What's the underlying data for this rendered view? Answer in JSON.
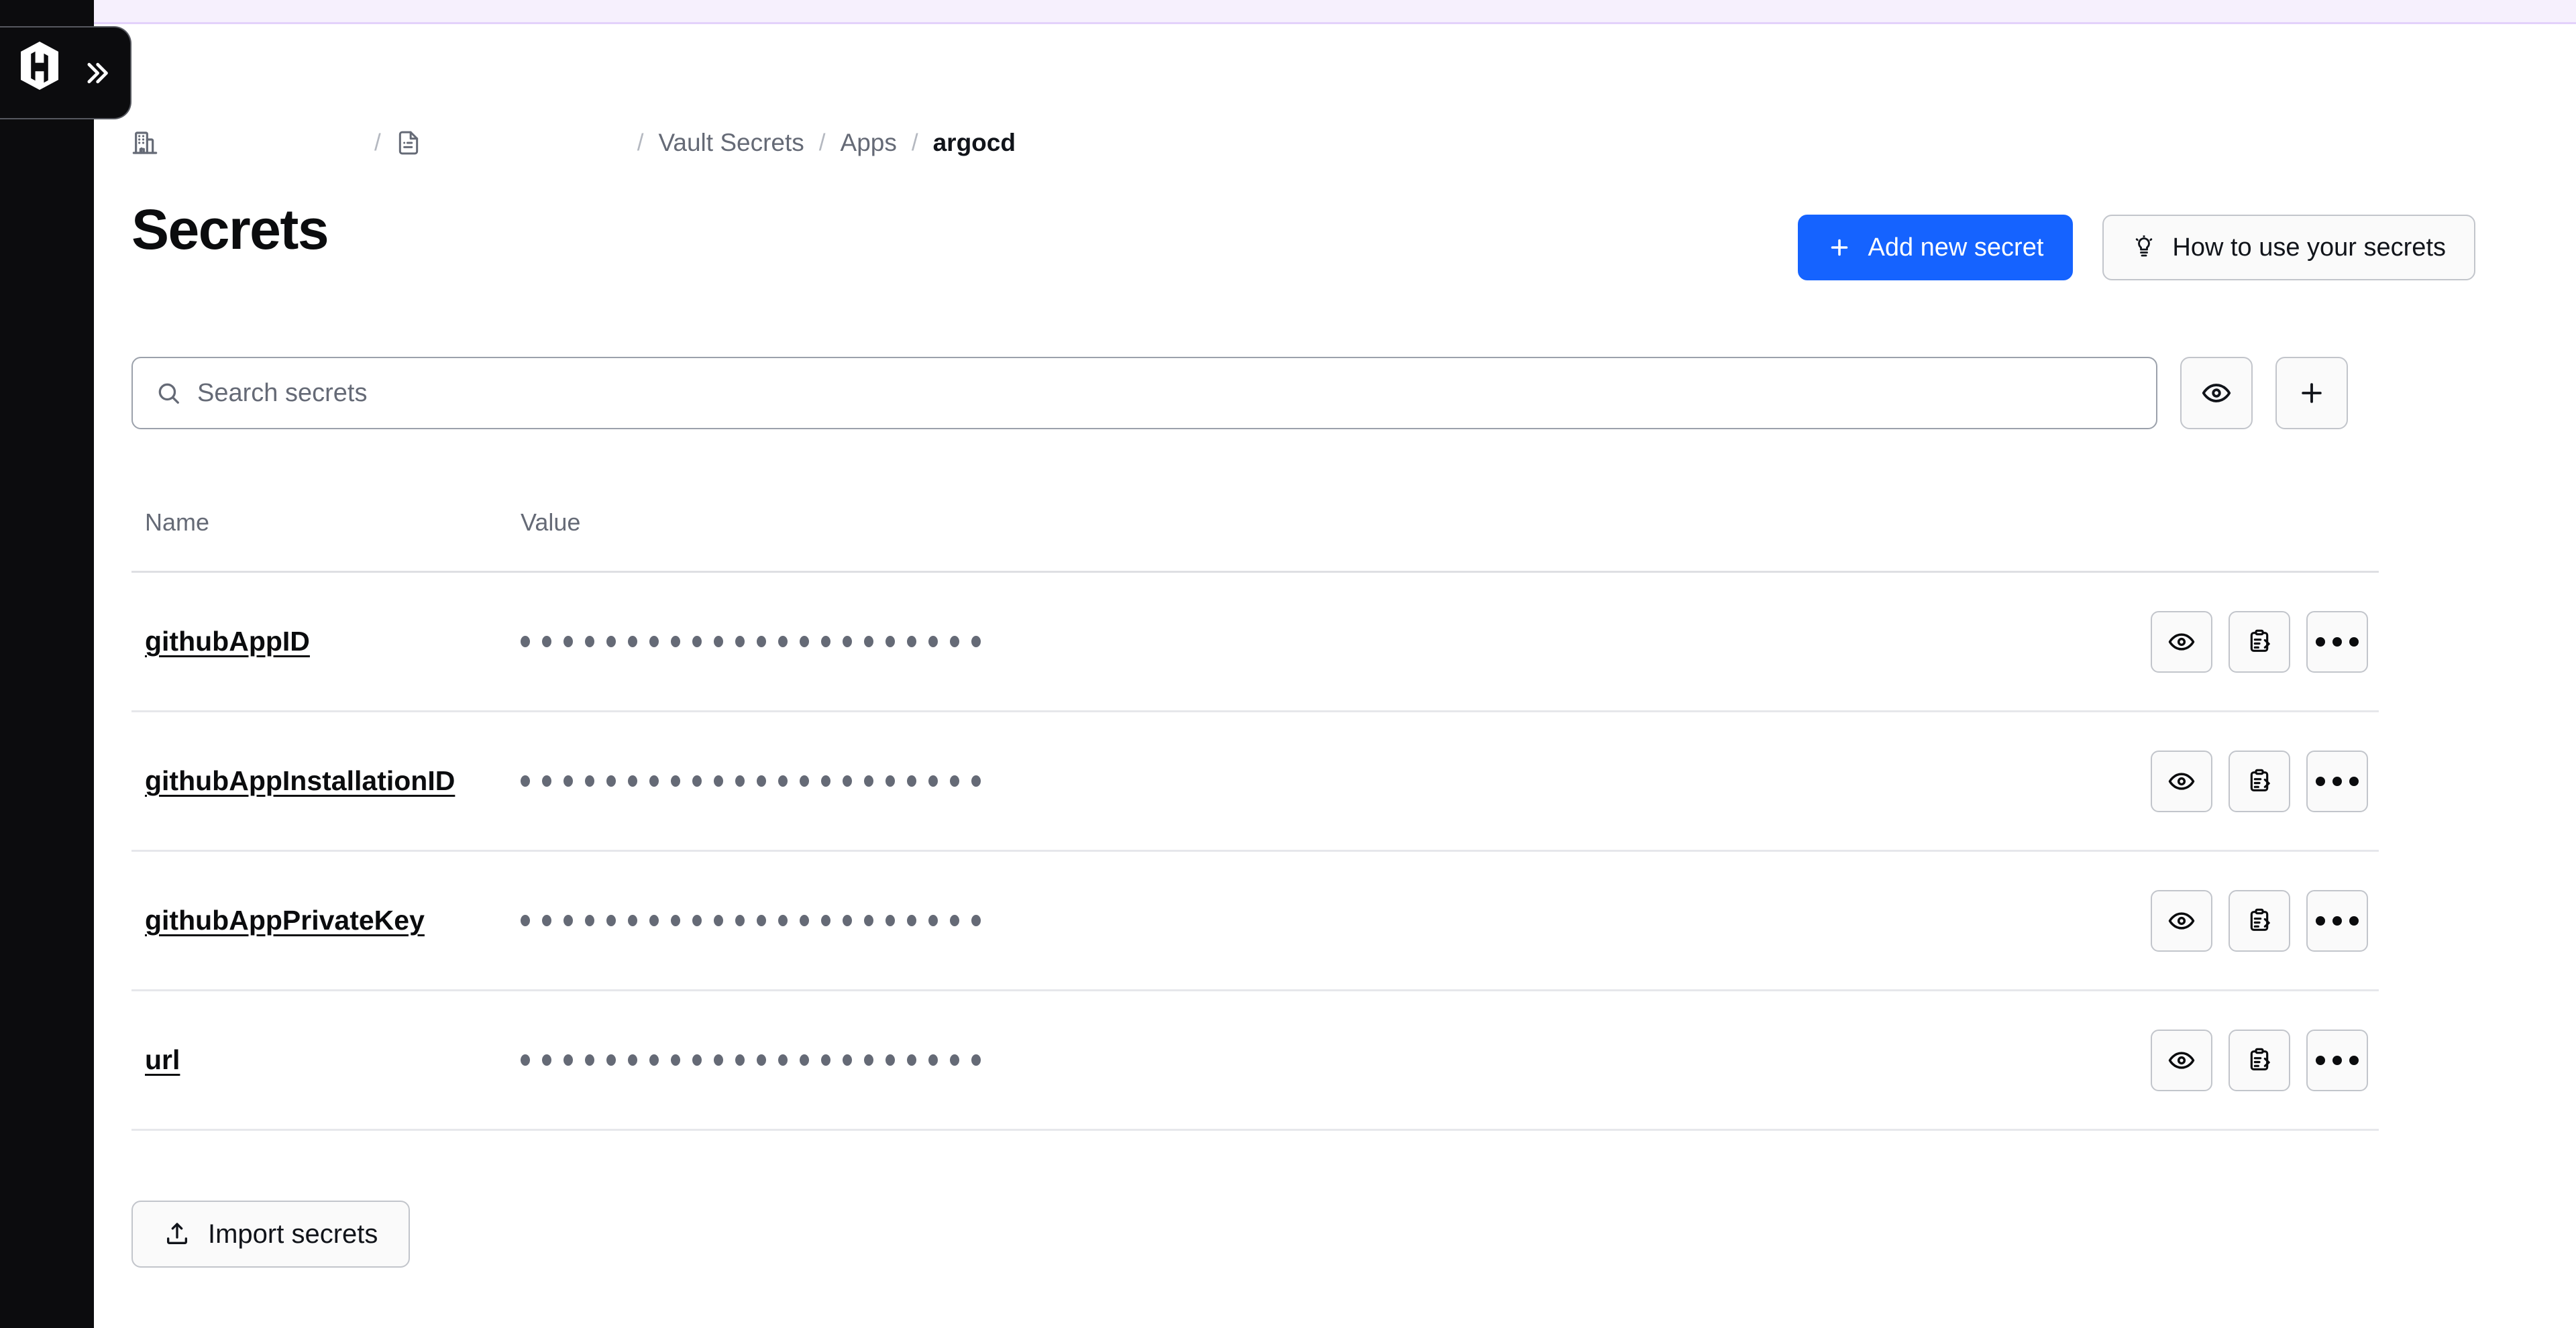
{
  "app": {
    "logo": "hashicorp-logo",
    "sidebar_expand_label": "»"
  },
  "breadcrumb": {
    "org_icon": "org-building-icon",
    "project_icon": "project-document-icon",
    "separator": "/",
    "items": [
      {
        "label": "Vault Secrets",
        "current": false
      },
      {
        "label": "Apps",
        "current": false
      },
      {
        "label": "argocd",
        "current": true
      }
    ]
  },
  "header": {
    "title": "Secrets",
    "add_secret_label": "Add new secret",
    "add_secret_icon": "plus-icon",
    "how_to_label": "How to use your secrets",
    "how_to_icon": "lightbulb-icon"
  },
  "search": {
    "placeholder": "Search secrets",
    "value": "",
    "icon": "search-icon",
    "reveal_all_icon": "eye-icon",
    "add_icon": "plus-icon"
  },
  "table": {
    "columns": [
      "Name",
      "Value"
    ],
    "row_actions": {
      "reveal_icon": "eye-icon",
      "copy_icon": "clipboard-copy-icon",
      "more_icon": "more-options-icon"
    },
    "masked_dot_count": 22,
    "rows": [
      {
        "name": "githubAppID",
        "value_masked": true
      },
      {
        "name": "githubAppInstallationID",
        "value_masked": true
      },
      {
        "name": "githubAppPrivateKey",
        "value_masked": true
      },
      {
        "name": "url",
        "value_masked": true
      }
    ]
  },
  "footer": {
    "import_label": "Import secrets",
    "import_icon": "upload-icon"
  },
  "colors": {
    "primary": "#1563ff",
    "sidebar": "#0c0c0e",
    "banner": "#f6f0fd",
    "muted_text": "#656a76"
  }
}
